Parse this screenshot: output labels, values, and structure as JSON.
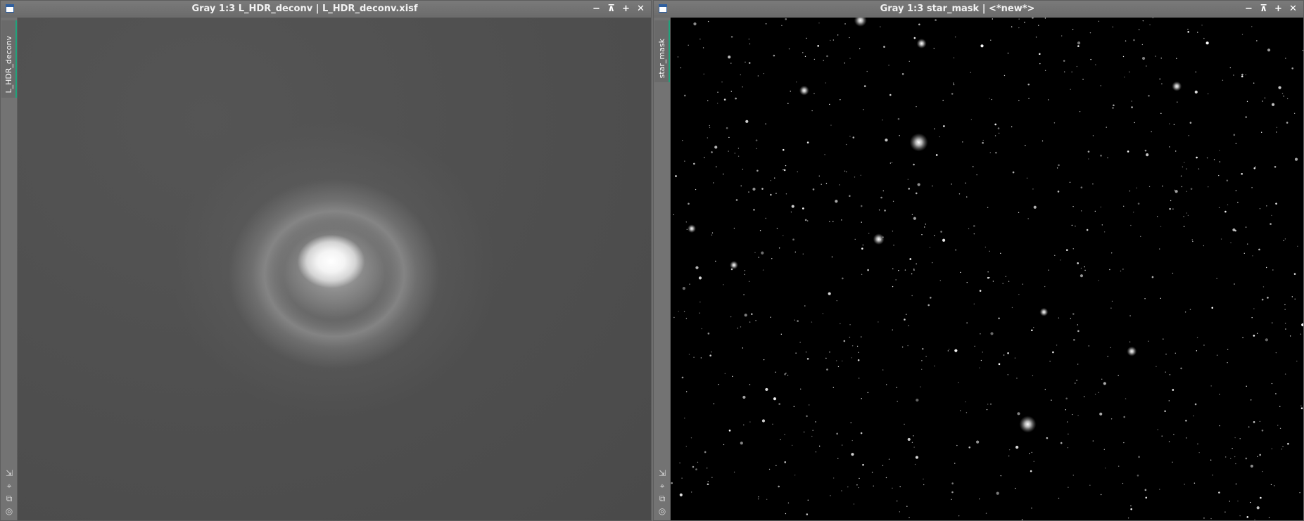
{
  "windows": {
    "left": {
      "title": "Gray 1:3 L_HDR_deconv | L_HDR_deconv.xisf",
      "view_tab": "L_HDR_deconv"
    },
    "right": {
      "title": "Gray 1:3 star_mask | <*new*>",
      "view_tab": "star_mask"
    }
  },
  "title_controls": {
    "minimize": "−",
    "shade": "⊼",
    "maximize": "+",
    "close": "✕"
  },
  "side_tools": {
    "fit": "⇲",
    "zoom": "⌖",
    "clone": "⧉",
    "preview": "◎"
  },
  "colors": {
    "titlebar": "#6f6f6f",
    "active_tab_accent": "#1fa37c",
    "window_icon": "#2f5f9f"
  },
  "icons": [
    "window-icon",
    "minimize-icon",
    "shade-icon",
    "maximize-icon",
    "close-icon",
    "fit-icon",
    "zoom-icon",
    "clone-icon",
    "preview-icon"
  ]
}
